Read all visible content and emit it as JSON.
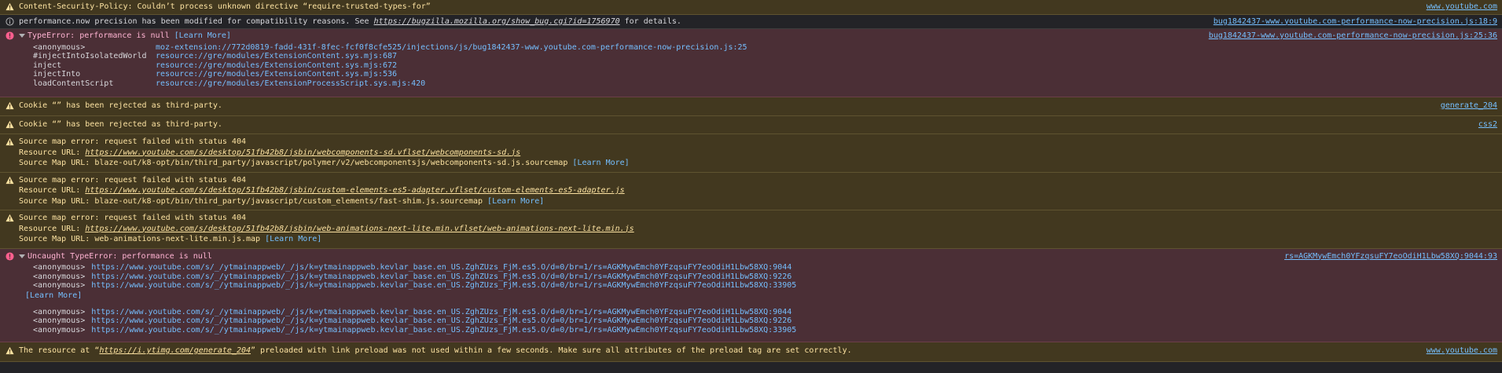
{
  "colors": {
    "warn_bg": "#42381f",
    "warn_text": "#fce2a1",
    "error_bg": "#4b2f36",
    "error_text": "#ffb3d2",
    "link": "#75bfff",
    "console_bg": "#232327"
  },
  "messages": [
    {
      "level": "warning",
      "icon": "warning-icon",
      "text": "Content-Security-Policy: Couldn’t process unknown directive “require-trusted-types-for”",
      "location": "www.youtube.com"
    },
    {
      "level": "info",
      "icon": "info-icon",
      "text_pre": "performance.now precision has been modified for compatibility reasons. See ",
      "link": "https://bugzilla.mozilla.org/show_bug.cgi?id=1756970",
      "text_post": " for details.",
      "location": "bug1842437-www.youtube.com-performance-now-precision.js:18:9"
    },
    {
      "level": "error",
      "icon": "error-icon",
      "text": "TypeError: performance is null ",
      "learn_more": "[Learn More]",
      "location": "bug1842437-www.youtube.com-performance-now-precision.js:25:36",
      "stack": [
        {
          "fn": "<anonymous>",
          "src": "moz-extension://772d0819-fadd-431f-8fec-fcf0f8cfe525/injections/js/bug1842437-www.youtube.com-performance-now-precision.js:25"
        },
        {
          "fn": "#injectIntoIsolatedWorld",
          "src": "resource://gre/modules/ExtensionContent.sys.mjs:687"
        },
        {
          "fn": "inject",
          "src": "resource://gre/modules/ExtensionContent.sys.mjs:672"
        },
        {
          "fn": "injectInto",
          "src": "resource://gre/modules/ExtensionContent.sys.mjs:536"
        },
        {
          "fn": "loadContentScript",
          "src": "resource://gre/modules/ExtensionProcessScript.sys.mjs:420"
        }
      ]
    },
    {
      "level": "warning",
      "icon": "warning-icon",
      "text": "Cookie “” has been rejected as third-party.",
      "location": "generate_204"
    },
    {
      "level": "warning",
      "icon": "warning-icon",
      "text": "Cookie “” has been rejected as third-party.",
      "location": "css2"
    },
    {
      "level": "warning",
      "icon": "warning-icon",
      "text": "Source map error: request failed with status 404",
      "resource_label": "Resource URL: ",
      "resource_url": "https://www.youtube.com/s/desktop/51fb42b8/jsbin/webcomponents-sd.vflset/webcomponents-sd.js",
      "sourcemap_label": "Source Map URL: ",
      "sourcemap_url": "blaze-out/k8-opt/bin/third_party/javascript/polymer/v2/webcomponentsjs/webcomponents-sd.js.sourcemap",
      "learn_more": "[Learn More]"
    },
    {
      "level": "warning",
      "icon": "warning-icon",
      "text": "Source map error: request failed with status 404",
      "resource_label": "Resource URL: ",
      "resource_url": "https://www.youtube.com/s/desktop/51fb42b8/jsbin/custom-elements-es5-adapter.vflset/custom-elements-es5-adapter.js",
      "sourcemap_label": "Source Map URL: ",
      "sourcemap_url": "blaze-out/k8-opt/bin/third_party/javascript/custom_elements/fast-shim.js.sourcemap",
      "learn_more": "[Learn More]"
    },
    {
      "level": "warning",
      "icon": "warning-icon",
      "text": "Source map error: request failed with status 404",
      "resource_label": "Resource URL: ",
      "resource_url": "https://www.youtube.com/s/desktop/51fb42b8/jsbin/web-animations-next-lite.min.vflset/web-animations-next-lite.min.js",
      "sourcemap_label": "Source Map URL: ",
      "sourcemap_url": "web-animations-next-lite.min.js.map",
      "learn_more": "[Learn More]"
    },
    {
      "level": "error",
      "icon": "error-icon",
      "text": "Uncaught TypeError: performance is null",
      "location": "rs=AGKMywEmch0YFzqsuFY7eoOdiH1Lbw58XQ:9044:93",
      "stack": [
        {
          "fn": "<anonymous>",
          "src": "https://www.youtube.com/s/_/ytmainappweb/_/js/k=ytmainappweb.kevlar_base.en_US.ZghZUzs_FjM.es5.O/d=0/br=1/rs=AGKMywEmch0YFzqsuFY7eoOdiH1Lbw58XQ:9044"
        },
        {
          "fn": "<anonymous>",
          "src": "https://www.youtube.com/s/_/ytmainappweb/_/js/k=ytmainappweb.kevlar_base.en_US.ZghZUzs_FjM.es5.O/d=0/br=1/rs=AGKMywEmch0YFzqsuFY7eoOdiH1Lbw58XQ:9226"
        },
        {
          "fn": "<anonymous>",
          "src": "https://www.youtube.com/s/_/ytmainappweb/_/js/k=ytmainappweb.kevlar_base.en_US.ZghZUzs_FjM.es5.O/d=0/br=1/rs=AGKMywEmch0YFzqsuFY7eoOdiH1Lbw58XQ:33905"
        }
      ],
      "learn_more": "[Learn More]",
      "stack2": [
        {
          "fn": "<anonymous>",
          "src": "https://www.youtube.com/s/_/ytmainappweb/_/js/k=ytmainappweb.kevlar_base.en_US.ZghZUzs_FjM.es5.O/d=0/br=1/rs=AGKMywEmch0YFzqsuFY7eoOdiH1Lbw58XQ:9044"
        },
        {
          "fn": "<anonymous>",
          "src": "https://www.youtube.com/s/_/ytmainappweb/_/js/k=ytmainappweb.kevlar_base.en_US.ZghZUzs_FjM.es5.O/d=0/br=1/rs=AGKMywEmch0YFzqsuFY7eoOdiH1Lbw58XQ:9226"
        },
        {
          "fn": "<anonymous>",
          "src": "https://www.youtube.com/s/_/ytmainappweb/_/js/k=ytmainappweb.kevlar_base.en_US.ZghZUzs_FjM.es5.O/d=0/br=1/rs=AGKMywEmch0YFzqsuFY7eoOdiH1Lbw58XQ:33905"
        }
      ]
    },
    {
      "level": "warning",
      "icon": "warning-icon",
      "text_pre": "The resource at “",
      "link": "https://i.ytimg.com/generate_204",
      "text_post": "” preloaded with link preload was not used within a few seconds. Make sure all attributes of the preload tag are set correctly.",
      "location": "www.youtube.com"
    }
  ]
}
